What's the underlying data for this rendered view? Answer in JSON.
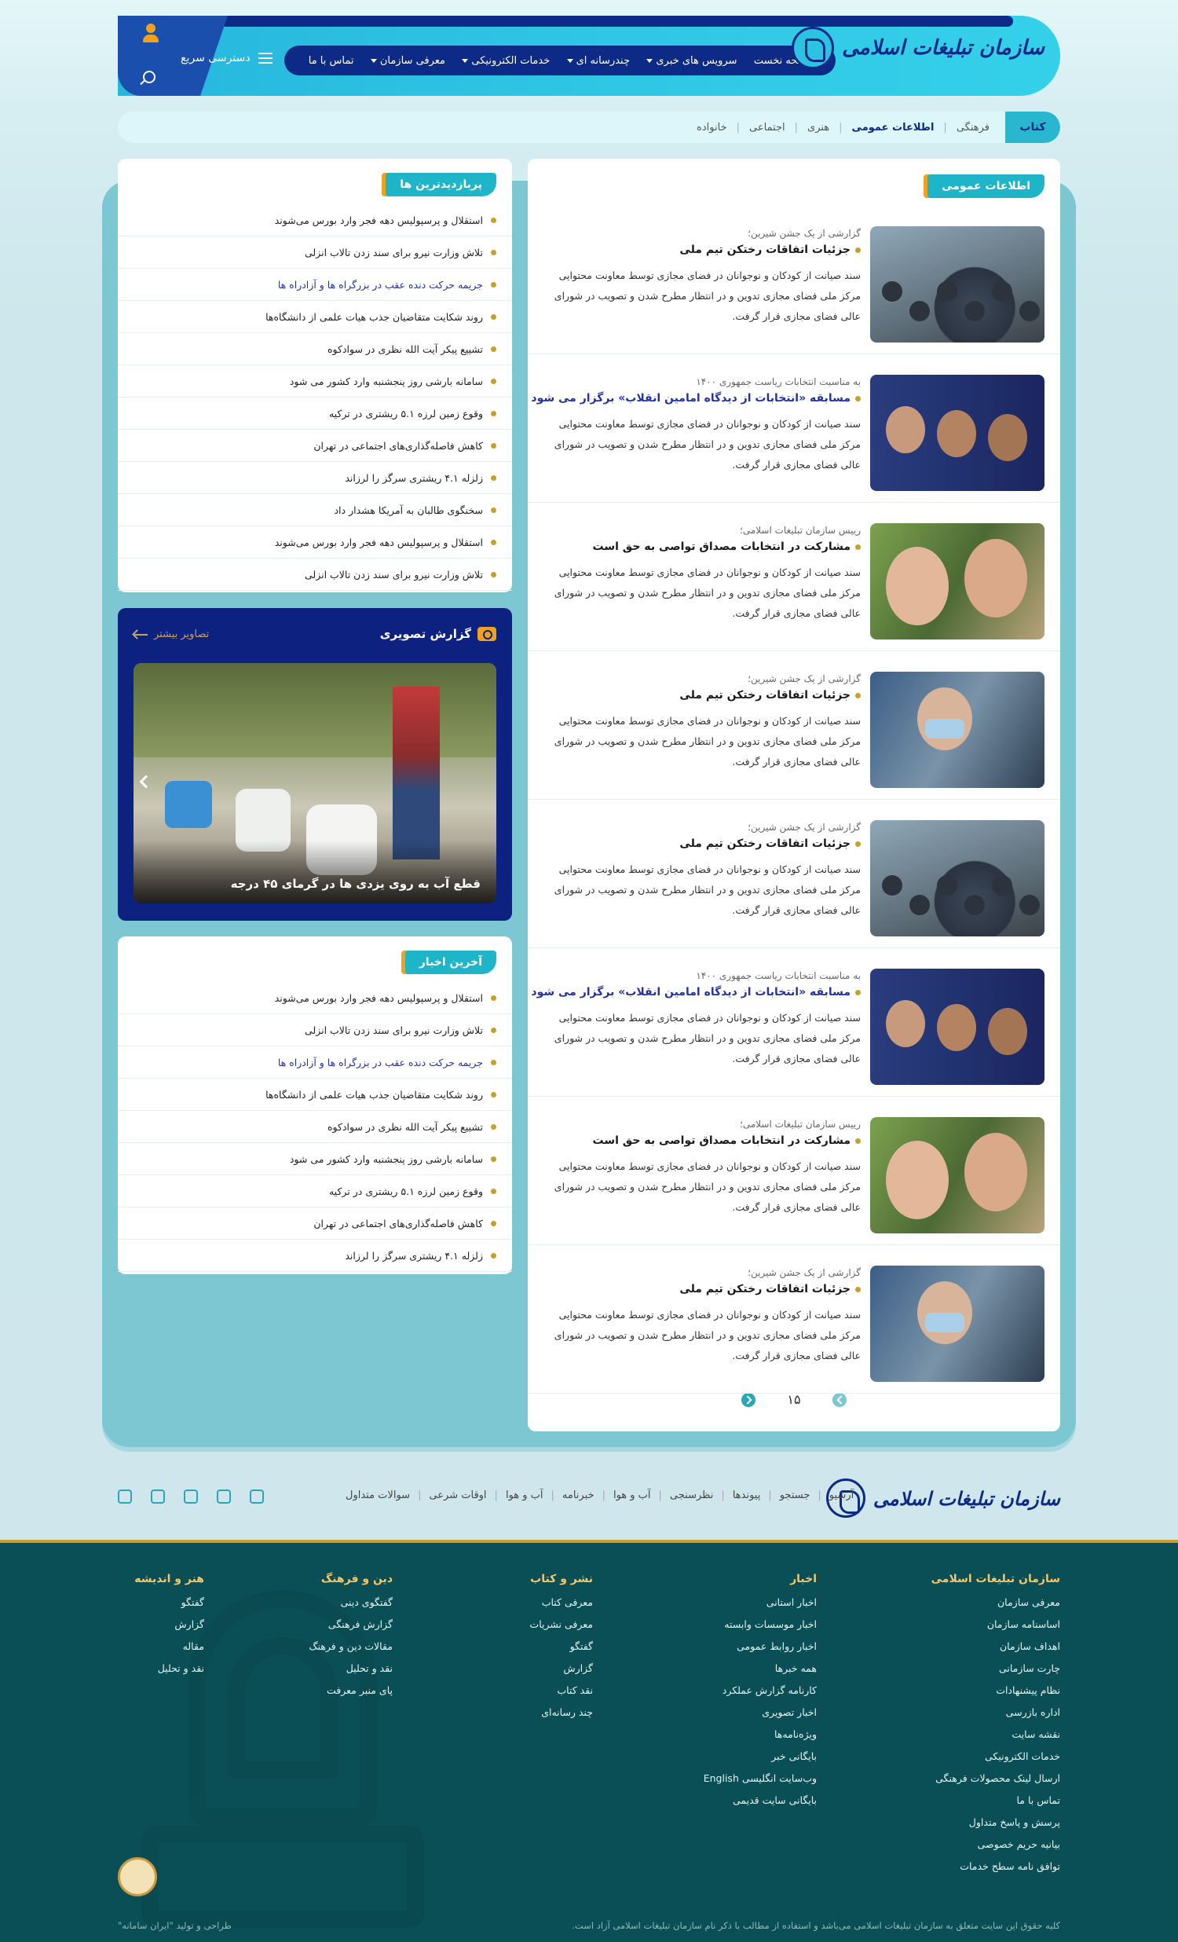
{
  "header": {
    "logo_text": "سازمان تبلیغات اسلامی",
    "quick_access": "دسترسی سریع",
    "nav": [
      {
        "label": "صفحه نخست",
        "dropdown": false
      },
      {
        "label": "سرویس های خبری",
        "dropdown": true
      },
      {
        "label": "چندرسانه ای",
        "dropdown": true
      },
      {
        "label": "خدمات الکترونیکی",
        "dropdown": true
      },
      {
        "label": "معرفی سازمان",
        "dropdown": true
      },
      {
        "label": "تماس با ما",
        "dropdown": false
      }
    ]
  },
  "subnav": {
    "tab": "کتاب",
    "items": [
      "فرهنگی",
      "اطلاعات عمومی",
      "هنری",
      "اجتماعی",
      "خانواده"
    ],
    "active": "اطلاعات عمومی"
  },
  "main": {
    "title": "اطلاعات عمومی",
    "items": [
      {
        "surtitle": "گزارشی از یک جشن شیرین؛",
        "title": "جزئیات اتفاقات رختکن تیم ملی",
        "blue": false,
        "image": "hall",
        "desc": "سند صیانت از کودکان و نوجوانان در فضای مجازی توسط معاونت محتوایی مرکز ملی فضای مجازی تدوین و در انتظار مطرح شدن و تصویب در شورای عالی فضای مجازی قرار گرفت."
      },
      {
        "surtitle": "به مناسبت انتخابات ریاست جمهوری ۱۴۰۰",
        "title": "مسابقه «انتخابات از دیدگاه امامین انقلاب» برگزار می شود",
        "blue": true,
        "image": "men",
        "desc": "سند صیانت از کودکان و نوجوانان در فضای مجازی توسط معاونت محتوایی مرکز ملی فضای مجازی تدوین و در انتظار مطرح شدن و تصویب در شورای عالی فضای مجازی قرار گرفت."
      },
      {
        "surtitle": "رییس سازمان تبلیغات اسلامی؛",
        "title": "مشارکت در انتخابات مصداق تواصی به حق است",
        "blue": false,
        "image": "women",
        "desc": "سند صیانت از کودکان و نوجوانان در فضای مجازی توسط معاونت محتوایی مرکز ملی فضای مجازی تدوین و در انتظار مطرح شدن و تصویب در شورای عالی فضای مجازی قرار گرفت."
      },
      {
        "surtitle": "گزارشی از یک جشن شیرین؛",
        "title": "جزئیات اتفاقات رختکن تیم ملی",
        "blue": false,
        "image": "nurse",
        "desc": "سند صیانت از کودکان و نوجوانان در فضای مجازی توسط معاونت محتوایی مرکز ملی فضای مجازی تدوین و در انتظار مطرح شدن و تصویب در شورای عالی فضای مجازی قرار گرفت."
      },
      {
        "surtitle": "گزارشی از یک جشن شیرین؛",
        "title": "جزئیات اتفاقات رختکن تیم ملی",
        "blue": false,
        "image": "hall",
        "desc": "سند صیانت از کودکان و نوجوانان در فضای مجازی توسط معاونت محتوایی مرکز ملی فضای مجازی تدوین و در انتظار مطرح شدن و تصویب در شورای عالی فضای مجازی قرار گرفت."
      },
      {
        "surtitle": "به مناسبت انتخابات ریاست جمهوری ۱۴۰۰",
        "title": "مسابقه «انتخابات از دیدگاه امامین انقلاب» برگزار می شود",
        "blue": true,
        "image": "men",
        "desc": "سند صیانت از کودکان و نوجوانان در فضای مجازی توسط معاونت محتوایی مرکز ملی فضای مجازی تدوین و در انتظار مطرح شدن و تصویب در شورای عالی فضای مجازی قرار گرفت."
      },
      {
        "surtitle": "رییس سازمان تبلیغات اسلامی؛",
        "title": "مشارکت در انتخابات مصداق تواصی به حق است",
        "blue": false,
        "image": "women",
        "desc": "سند صیانت از کودکان و نوجوانان در فضای مجازی توسط معاونت محتوایی مرکز ملی فضای مجازی تدوین و در انتظار مطرح شدن و تصویب در شورای عالی فضای مجازی قرار گرفت."
      },
      {
        "surtitle": "گزارشی از یک جشن شیرین؛",
        "title": "جزئیات اتفاقات رختکن تیم ملی",
        "blue": false,
        "image": "nurse",
        "desc": "سند صیانت از کودکان و نوجوانان در فضای مجازی توسط معاونت محتوایی مرکز ملی فضای مجازی تدوین و در انتظار مطرح شدن و تصویب در شورای عالی فضای مجازی قرار گرفت."
      }
    ],
    "page": "۱۵"
  },
  "most_viewed": {
    "title": "پربازدیدترین ها",
    "items": [
      {
        "text": "استقلال و پرسپولیس دهه فجر وارد بورس می‌شوند",
        "blue": false
      },
      {
        "text": "تلاش وزارت نیرو برای سند زدن تالاب انزلی",
        "blue": false
      },
      {
        "text": "جریمه حرکت دنده عقب در بزرگراه ها و آزادراه ها",
        "blue": true
      },
      {
        "text": "روند شکایت متقاضیان جذب هیات علمی از دانشگاه‌ها",
        "blue": false
      },
      {
        "text": "تشییع پیکر آیت الله نظری در سوادکوه",
        "blue": false
      },
      {
        "text": "سامانه بارشی روز پنجشنبه وارد کشور می شود",
        "blue": false
      },
      {
        "text": "وقوع زمین لرزه ۵.۱ ریشتری در ترکیه",
        "blue": false
      },
      {
        "text": "کاهش فاصله‌گذاری‌های اجتماعی در تهران",
        "blue": false
      },
      {
        "text": "زلزله ۴.۱ ریشتری سرگز را لرزاند",
        "blue": false
      },
      {
        "text": "سخنگوی طالبان به آمریکا هشدار داد",
        "blue": false
      },
      {
        "text": "استقلال و پرسپولیس دهه فجر وارد بورس می‌شوند",
        "blue": false
      },
      {
        "text": "تلاش وزارت نیرو برای سند زدن تالاب انزلی",
        "blue": false
      }
    ]
  },
  "photo_report": {
    "title": "گزارش تصویری",
    "more": "تصاویر بیشتر",
    "caption": "قطع آب به روی یزدی ها در گرمای ۴۵ درجه"
  },
  "latest_news": {
    "title": "آخرین اخبار",
    "items": [
      {
        "text": "استقلال و پرسپولیس دهه فجر وارد بورس می‌شوند",
        "blue": false
      },
      {
        "text": "تلاش وزارت نیرو برای سند زدن تالاب انزلی",
        "blue": false
      },
      {
        "text": "جریمه حرکت دنده عقب در بزرگراه ها و آزادراه ها",
        "blue": true
      },
      {
        "text": "روند شکایت متقاضیان جذب هیات علمی از دانشگاه‌ها",
        "blue": false
      },
      {
        "text": "تشییع پیکر آیت الله نظری در سوادکوه",
        "blue": false
      },
      {
        "text": "سامانه بارشی روز پنجشنبه وارد کشور می شود",
        "blue": false
      },
      {
        "text": "وقوع زمین لرزه ۵.۱ ریشتری در ترکیه",
        "blue": false
      },
      {
        "text": "کاهش فاصله‌گذاری‌های اجتماعی در تهران",
        "blue": false
      },
      {
        "text": "زلزله ۴.۱ ریشتری سرگز را لرزاند",
        "blue": false
      }
    ]
  },
  "footer_top": {
    "links": [
      "آرشیو",
      "جستجو",
      "پیوندها",
      "نظرسنجی",
      "آب و هوا",
      "خبرنامه",
      "آب و هوا",
      "اوقات شرعی",
      "سوالات متداول"
    ],
    "social": [
      "rss-icon",
      "twitter-icon",
      "telegram-icon",
      "instagram-icon",
      "aparat-icon"
    ]
  },
  "footer": {
    "columns": [
      {
        "title": "سازمان تبلیغات اسلامی",
        "items": [
          "معرفی سازمان",
          "اساسنامه سازمان",
          "اهداف سازمان",
          "چارت سازمانی",
          "نظام پیشنهادات",
          "اداره بازرسی",
          "نقشه سایت",
          "خدمات الکترونیکی",
          "ارسال لینک محصولات فرهنگی",
          "تماس با ما",
          "پرسش و پاسخ متداول",
          "بیانیه حریم خصوصی",
          "توافق نامه سطح خدمات"
        ]
      },
      {
        "title": "اخبار",
        "items": [
          "اخبار استانی",
          "اخبار موسسات وابسته",
          "اخبار روابط عمومی",
          "همه خبرها",
          "کارنامه گزارش عملکرد",
          "اخبار تصویری",
          "ویژه‌نامه‌ها",
          "بایگانی خبر",
          "وب‌سایت انگلیسی English",
          "بایگانی سایت قدیمی"
        ]
      },
      {
        "title": "نشر و کتاب",
        "items": [
          "معرفی کتاب",
          "معرفی نشریات",
          "گفتگو",
          "گزارش",
          "نقد کتاب",
          "چند رسانه‌ای"
        ]
      },
      {
        "title": "دین و فرهنگ",
        "items": [
          "گفتگوی دینی",
          "گزارش فرهنگی",
          "مقالات دین و فرهنگ",
          "نقد و تحلیل",
          "پای منبر معرفت"
        ]
      },
      {
        "title": "هنر و اندیشه",
        "items": [
          "گفتگو",
          "گزارش",
          "مقاله",
          "نقد و تحلیل"
        ]
      }
    ],
    "copyright": "کلیه حقوق این سایت متعلق به سازمان تبلیغات اسلامی می‌باشد و استفاده از مطالب با ذکر نام سازمان تبلیغات اسلامی آزاد است.",
    "credit": "طراحی و تولید \"ایران سامانه\""
  }
}
